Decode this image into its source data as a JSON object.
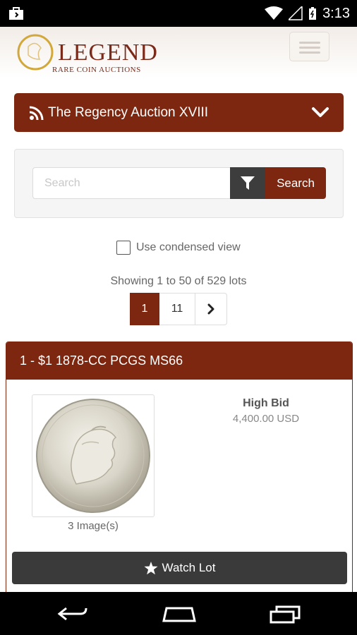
{
  "status_bar": {
    "time": "3:13"
  },
  "header": {
    "logo_name": "LEGEND",
    "logo_tagline": "RARE COIN AUCTIONS"
  },
  "auction": {
    "title": "The Regency Auction XVIII"
  },
  "search": {
    "placeholder": "Search",
    "button_label": "Search"
  },
  "view_options": {
    "condensed_label": "Use condensed view"
  },
  "results": {
    "summary": "Showing 1 to 50 of 529 lots",
    "pages": [
      "1",
      "11"
    ]
  },
  "lot": {
    "title": "1 - $1 1878-CC PCGS MS66",
    "images_label": "3 Image(s)",
    "bid_label": "High Bid",
    "bid_value": "4,400.00 USD",
    "watch_label": "Watch Lot"
  },
  "colors": {
    "brand": "#7d2710",
    "dark_button": "#3a3a3a"
  }
}
